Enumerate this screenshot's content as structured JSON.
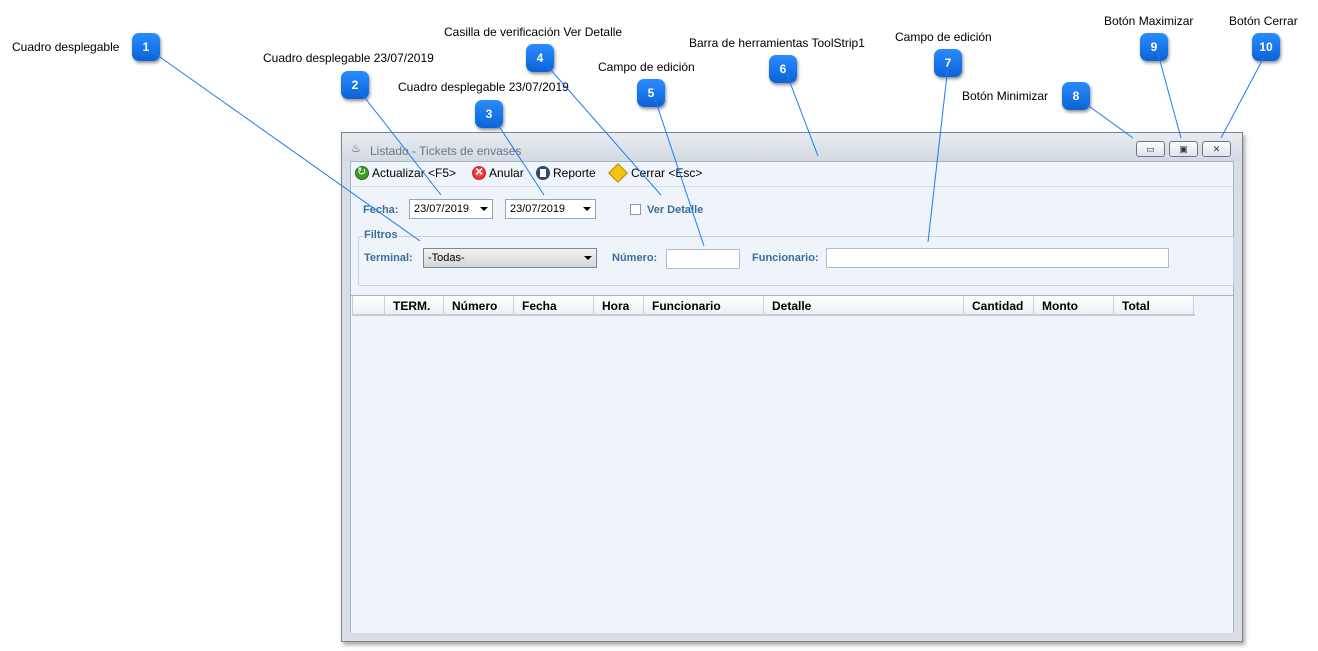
{
  "annotations": [
    {
      "num": "1",
      "label": "Cuadro desplegable"
    },
    {
      "num": "2",
      "label": "Cuadro desplegable 23/07/2019"
    },
    {
      "num": "3",
      "label": "Cuadro desplegable 23/07/2019"
    },
    {
      "num": "4",
      "label": "Casilla de verificación Ver Detalle"
    },
    {
      "num": "5",
      "label": "Campo de edición"
    },
    {
      "num": "6",
      "label": "Barra de herramientas ToolStrip1"
    },
    {
      "num": "7",
      "label": "Campo de edición"
    },
    {
      "num": "8",
      "label": "Botón Minimizar"
    },
    {
      "num": "9",
      "label": "Botón Maximizar"
    },
    {
      "num": "10",
      "label": "Botón Cerrar"
    }
  ],
  "window": {
    "title": "Listado - Tickets de envases",
    "icon": "java-cup-icon",
    "buttons": {
      "minimize": "▭",
      "maximize": "▣",
      "close": "✕"
    }
  },
  "toolbar": {
    "refresh": "Actualizar <F5>",
    "cancel": "Anular",
    "report": "Reporte",
    "close": "Cerrar <Esc>"
  },
  "form": {
    "fecha_label": "Fecha:",
    "date_from": "23/07/2019",
    "date_to": "23/07/2019",
    "detail_label": "Ver Detalle",
    "filters_title": "Filtros",
    "terminal_label": "Terminal:",
    "terminal_value": "-Todas-",
    "numero_label": "Número:",
    "numero_value": "",
    "funcionario_label": "Funcionario:",
    "funcionario_value": ""
  },
  "grid": {
    "columns": [
      "TERM.",
      "Número",
      "Fecha",
      "Hora",
      "Funcionario",
      "Detalle",
      "Cantidad",
      "Monto",
      "Total"
    ]
  },
  "colors": {
    "label_blue": "#3e6c9a",
    "badge_blue": "#1a7cf0",
    "leader_line": "#1a7cf0"
  }
}
